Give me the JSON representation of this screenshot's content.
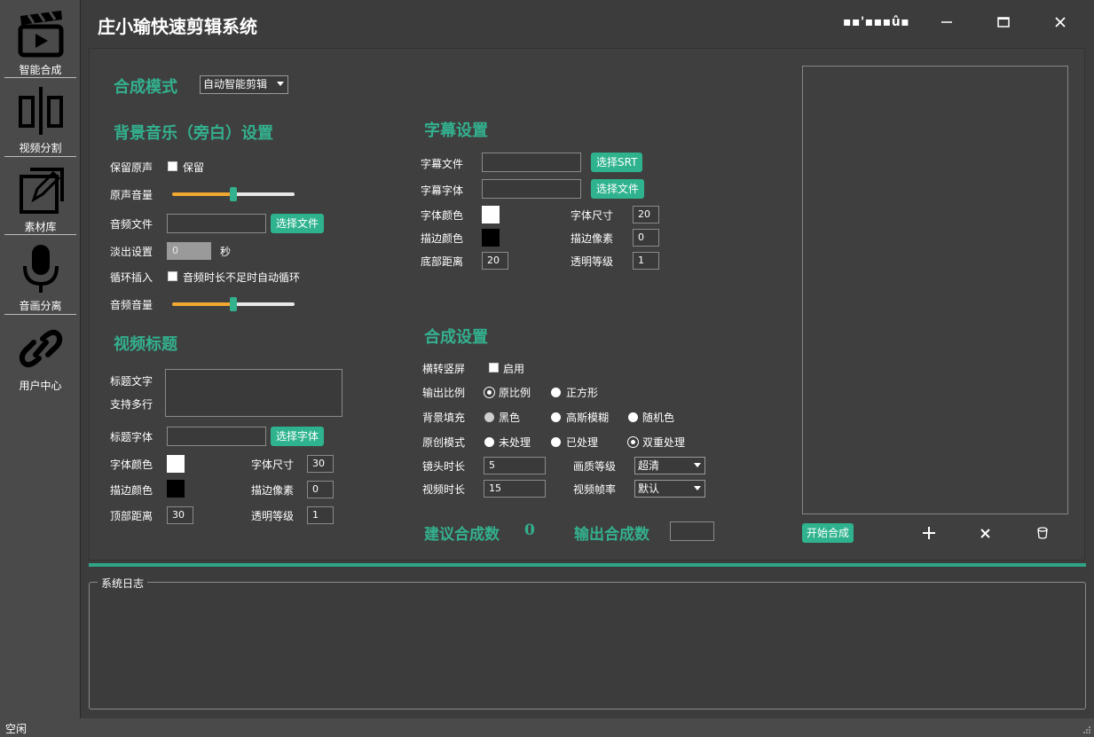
{
  "app": {
    "title": "庄小瑜快速剪辑系统",
    "title_glyphs": "▪▪'▪▪▪û▪"
  },
  "sidebar": {
    "items": [
      {
        "label": "智能合成",
        "icon": "clapperboard-icon"
      },
      {
        "label": "视频分割",
        "icon": "split-icon"
      },
      {
        "label": "素材库",
        "icon": "edit-square-icon"
      },
      {
        "label": "音画分离",
        "icon": "microphone-icon"
      },
      {
        "label": "用户中心",
        "icon": "link-icon"
      }
    ]
  },
  "mode": {
    "label": "合成模式",
    "selected": "自动智能剪辑"
  },
  "bgm": {
    "title": "背景音乐（旁白）设置",
    "keep_original_label": "保留原声",
    "keep_checkbox_text": "保留",
    "original_volume_label": "原声音量",
    "original_volume_value": 0.5,
    "audio_file_label": "音频文件",
    "audio_file_value": "",
    "select_file_button": "选择文件",
    "fade_label": "淡出设置",
    "fade_value": "0",
    "fade_unit": "秒",
    "loop_label": "循环插入",
    "loop_checkbox_text": "音频时长不足时自动循环",
    "audio_volume_label": "音频音量",
    "audio_volume_value": 0.5
  },
  "video_title": {
    "title": "视频标题",
    "text_label": "标题文字",
    "multiline_label": "支持多行",
    "text_value": "",
    "font_label": "标题字体",
    "font_value": "",
    "select_font_button": "选择字体",
    "font_color_label": "字体颜色",
    "font_color": "#ffffff",
    "font_size_label": "字体尺寸",
    "font_size_value": "30",
    "stroke_color_label": "描边颜色",
    "stroke_color": "#000000",
    "stroke_px_label": "描边像素",
    "stroke_px_value": "0",
    "top_distance_label": "顶部距离",
    "top_distance_value": "30",
    "opacity_label": "透明等级",
    "opacity_value": "1"
  },
  "subtitle": {
    "title": "字幕设置",
    "file_label": "字幕文件",
    "file_value": "",
    "select_srt_button": "选择SRT",
    "font_label": "字幕字体",
    "font_value": "",
    "select_file_button": "选择文件",
    "font_color_label": "字体颜色",
    "font_color": "#ffffff",
    "font_size_label": "字体尺寸",
    "font_size_value": "20",
    "stroke_color_label": "描边颜色",
    "stroke_color": "#000000",
    "stroke_px_label": "描边像素",
    "stroke_px_value": "0",
    "bottom_distance_label": "底部距离",
    "bottom_distance_value": "20",
    "opacity_label": "透明等级",
    "opacity_value": "1"
  },
  "compose": {
    "title": "合成设置",
    "portrait_label": "横转竖屏",
    "portrait_checkbox_text": "启用",
    "ratio_label": "输出比例",
    "ratio_options": [
      "原比例",
      "正方形"
    ],
    "bg_fill_label": "背景填充",
    "bg_fill_options": [
      "黑色",
      "高斯模糊",
      "随机色"
    ],
    "original_mode_label": "原创模式",
    "original_mode_options": [
      "未处理",
      "已处理",
      "双重处理"
    ],
    "shot_duration_label": "镜头时长",
    "shot_duration_value": "5",
    "quality_label": "画质等级",
    "quality_value": "超清",
    "video_duration_label": "视频时长",
    "video_duration_value": "15",
    "fps_label": "视频帧率",
    "fps_value": "默认",
    "suggest_label": "建议合成数",
    "suggest_value": "0",
    "output_label": "输出合成数",
    "output_value": ""
  },
  "preview": {
    "start_button": "开始合成"
  },
  "log": {
    "title": "系统日志"
  },
  "status": {
    "text": "空闲"
  },
  "colors": {
    "accent": "#33b08e",
    "slider_fill": "#f0a830",
    "background": "#3c3c3c"
  }
}
